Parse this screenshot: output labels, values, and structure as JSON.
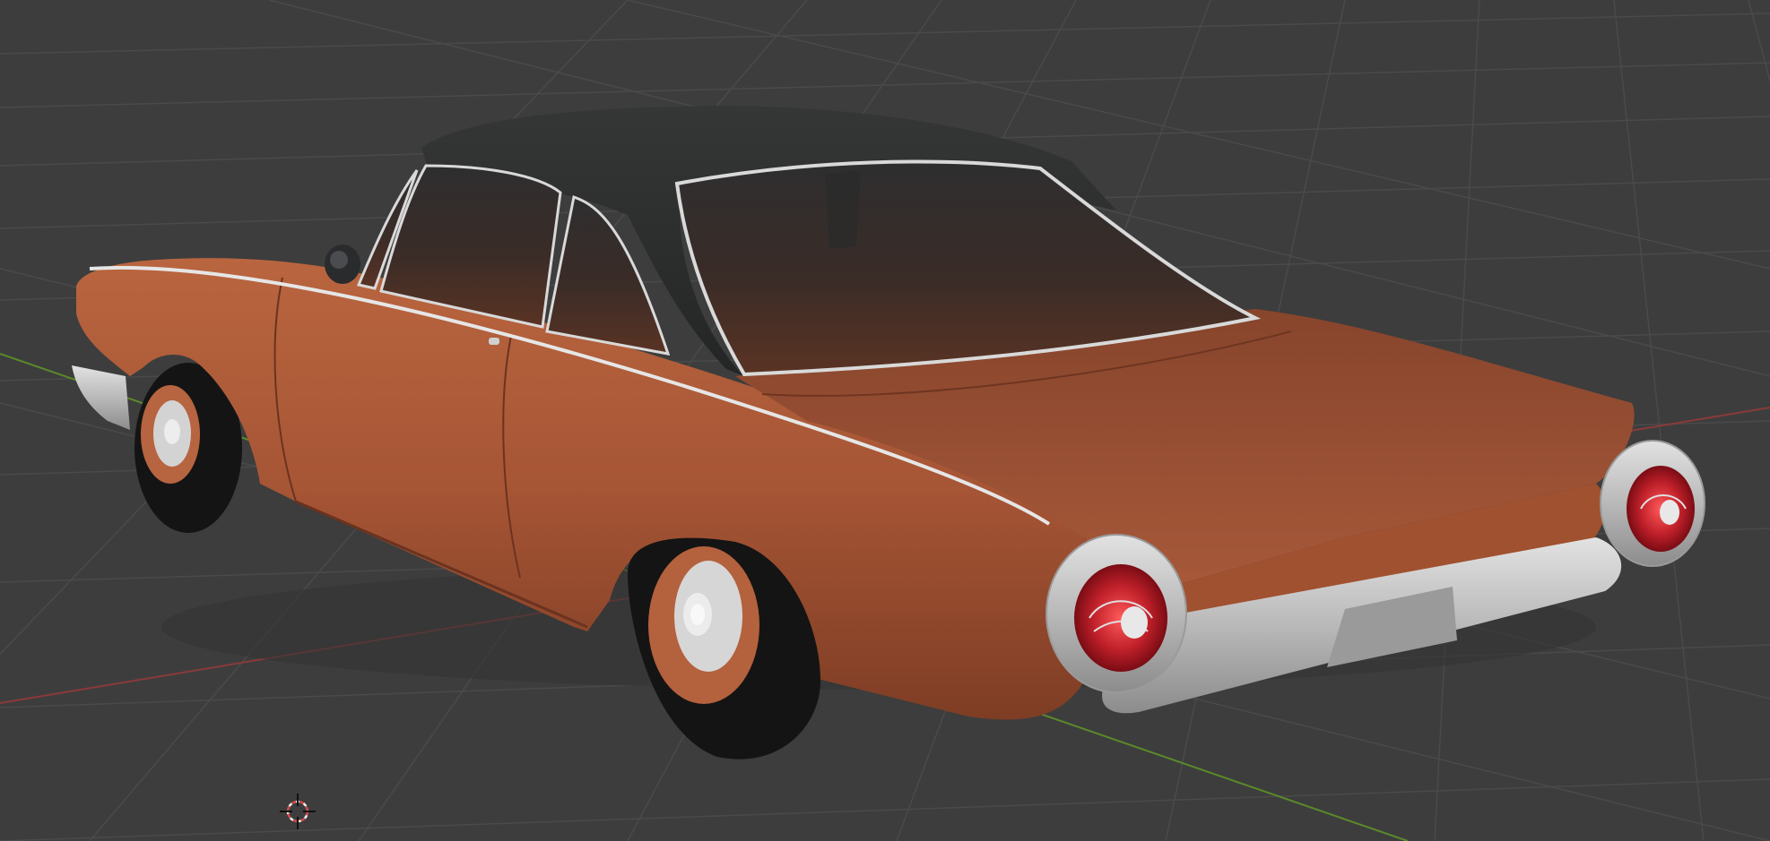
{
  "viewport": {
    "background": "#3d3d3d",
    "grid_color": "#4a4a4a",
    "x_axis_color": "#8a3a3a",
    "y_axis_color": "#5a8a2a",
    "grid_visible": true
  },
  "scene": {
    "object": "car",
    "body_color": "#a65535",
    "roof_color": "#2b2c2c",
    "chrome_color": "#c8c8c8",
    "tire_color": "#141414",
    "taillight_color": "#b51c22"
  },
  "icons": {
    "cursor": "3d-cursor-icon"
  }
}
